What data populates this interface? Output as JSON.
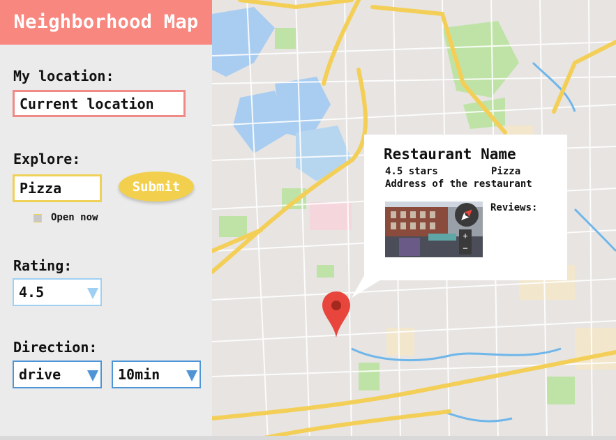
{
  "app": {
    "title": "Neighborhood Map"
  },
  "location": {
    "label": "My location:",
    "value": "Current location"
  },
  "explore": {
    "label": "Explore:",
    "value": "Pizza",
    "submit": "Submit",
    "open_now": "Open now"
  },
  "rating": {
    "label": "Rating:",
    "value": "4.5"
  },
  "direction": {
    "label": "Direction:",
    "mode": "drive",
    "time": "10min"
  },
  "popup": {
    "name": "Restaurant Name",
    "stars": "4.5 stars",
    "category": "Pizza",
    "address": "Address of the restaurant",
    "reviews_label": "Reviews:"
  },
  "colors": {
    "header": "#f8877f",
    "accent_yellow": "#f2d04e",
    "select_blue": "#4f95d6",
    "marker": "#e8453c"
  },
  "icons": [
    "dropdown-arrow-icon",
    "map-marker-icon",
    "compass-icon",
    "zoom-in-icon",
    "zoom-out-icon"
  ]
}
